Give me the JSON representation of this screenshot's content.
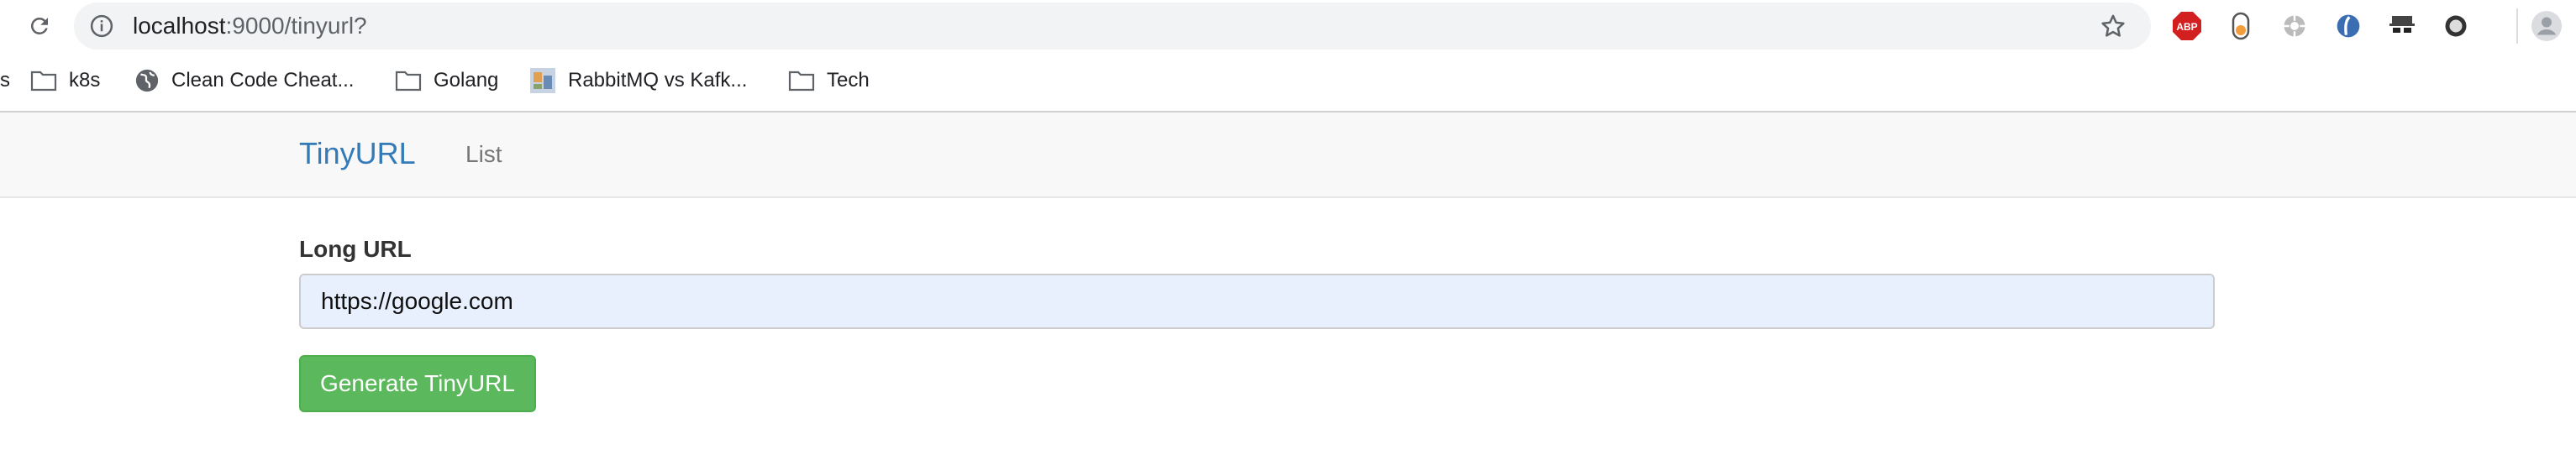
{
  "browser": {
    "url_host": "localhost",
    "url_path": ":9000/tinyurl?",
    "extensions": [
      "abp-icon",
      "toggle-extension-icon",
      "gear-extension-icon",
      "shield-extension-icon",
      "incognito-extension-icon",
      "circle-extension-icon",
      "profile-avatar-icon"
    ],
    "abp_label": "ABP"
  },
  "bookmarks": [
    {
      "label": "s",
      "icon": "none"
    },
    {
      "label": "k8s",
      "icon": "folder-icon"
    },
    {
      "label": "Clean Code Cheat...",
      "icon": "globe-icon"
    },
    {
      "label": "Golang",
      "icon": "folder-icon"
    },
    {
      "label": "RabbitMQ vs Kafk...",
      "icon": "favicon-icon"
    },
    {
      "label": "Tech",
      "icon": "folder-icon"
    }
  ],
  "navbar": {
    "brand": "TinyURL",
    "links": [
      "List"
    ]
  },
  "form": {
    "label": "Long URL",
    "value": "https://google.com",
    "submit_label": "Generate TinyURL"
  },
  "colors": {
    "brand": "#337ab7",
    "button": "#5cb85c",
    "input_bg": "#e8f0fe",
    "abp_red": "#d21f1f"
  }
}
